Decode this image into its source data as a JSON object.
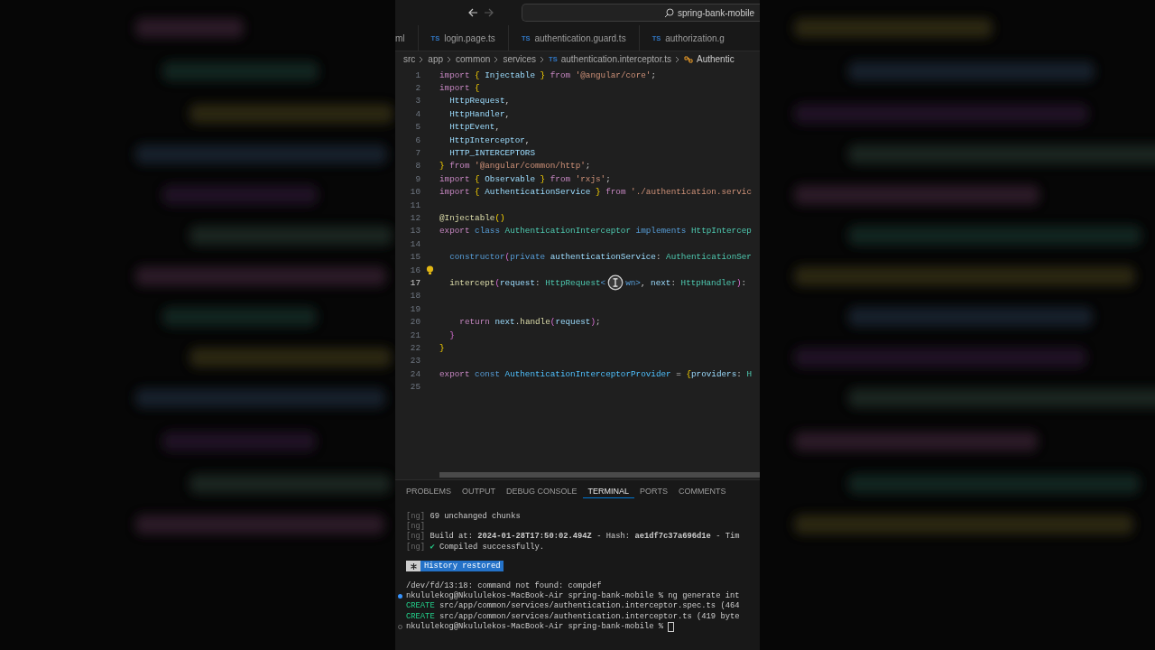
{
  "title_bar": {
    "search": {
      "value": "spring-bank-mobile"
    }
  },
  "tabs": [
    {
      "label": "ml",
      "selected": false
    },
    {
      "label": "login.page.ts",
      "selected": false,
      "badge": "TS"
    },
    {
      "label": "authentication.guard.ts",
      "selected": false,
      "badge": "TS"
    },
    {
      "label": "authorization.g",
      "selected": false,
      "badge": "TS"
    }
  ],
  "breadcrumb": [
    {
      "text": "src",
      "kind": "folder"
    },
    {
      "text": "app",
      "kind": "folder"
    },
    {
      "text": "common",
      "kind": "folder"
    },
    {
      "text": "services",
      "kind": "folder"
    },
    {
      "text": "authentication.interceptor.ts",
      "kind": "file",
      "badge": "TS"
    },
    {
      "text": "Authentic",
      "kind": "class"
    }
  ],
  "editor": {
    "lines": [
      {
        "number": "1",
        "current": false,
        "lightbulb": false,
        "tokens": [
          {
            "kind": "keyword",
            "text": "import "
          },
          {
            "kind": "bracket1",
            "text": "{ "
          },
          {
            "kind": "var",
            "text": "Injectable "
          },
          {
            "kind": "bracket1",
            "text": "} "
          },
          {
            "kind": "keyword",
            "text": "from "
          },
          {
            "kind": "string",
            "text": "'@angular/core'"
          },
          {
            "kind": "plain",
            "text": ";"
          }
        ]
      },
      {
        "number": "2",
        "current": false,
        "lightbulb": false,
        "tokens": [
          {
            "kind": "keyword",
            "text": "import "
          },
          {
            "kind": "bracket1",
            "text": "{"
          }
        ]
      },
      {
        "number": "3",
        "current": false,
        "lightbulb": false,
        "tokens": [
          {
            "kind": "var",
            "text": "  HttpRequest"
          },
          {
            "kind": "plain",
            "text": ","
          }
        ]
      },
      {
        "number": "4",
        "current": false,
        "lightbulb": false,
        "tokens": [
          {
            "kind": "var",
            "text": "  HttpHandler"
          },
          {
            "kind": "plain",
            "text": ","
          }
        ]
      },
      {
        "number": "5",
        "current": false,
        "lightbulb": false,
        "tokens": [
          {
            "kind": "var",
            "text": "  HttpEvent"
          },
          {
            "kind": "plain",
            "text": ","
          }
        ]
      },
      {
        "number": "6",
        "current": false,
        "lightbulb": false,
        "tokens": [
          {
            "kind": "var",
            "text": "  HttpInterceptor"
          },
          {
            "kind": "plain",
            "text": ","
          }
        ]
      },
      {
        "number": "7",
        "current": false,
        "lightbulb": false,
        "tokens": [
          {
            "kind": "var",
            "text": "  HTTP_INTERCEPTORS"
          }
        ]
      },
      {
        "number": "8",
        "current": false,
        "lightbulb": false,
        "tokens": [
          {
            "kind": "bracket1",
            "text": "} "
          },
          {
            "kind": "keyword",
            "text": "from "
          },
          {
            "kind": "string",
            "text": "'@angular/common/http'"
          },
          {
            "kind": "plain",
            "text": ";"
          }
        ]
      },
      {
        "number": "9",
        "current": false,
        "lightbulb": false,
        "tokens": [
          {
            "kind": "keyword",
            "text": "import "
          },
          {
            "kind": "bracket1",
            "text": "{ "
          },
          {
            "kind": "var",
            "text": "Observable "
          },
          {
            "kind": "bracket1",
            "text": "} "
          },
          {
            "kind": "keyword",
            "text": "from "
          },
          {
            "kind": "string",
            "text": "'rxjs'"
          },
          {
            "kind": "plain",
            "text": ";"
          }
        ]
      },
      {
        "number": "10",
        "current": false,
        "lightbulb": false,
        "tokens": [
          {
            "kind": "keyword",
            "text": "import "
          },
          {
            "kind": "bracket1",
            "text": "{ "
          },
          {
            "kind": "var",
            "text": "AuthenticationService "
          },
          {
            "kind": "bracket1",
            "text": "} "
          },
          {
            "kind": "keyword",
            "text": "from "
          },
          {
            "kind": "string",
            "text": "'./authentication.servic"
          }
        ]
      },
      {
        "number": "11",
        "current": false,
        "lightbulb": false
      },
      {
        "number": "12",
        "current": false,
        "lightbulb": false,
        "tokens": [
          {
            "kind": "func",
            "text": "@Injectable"
          },
          {
            "kind": "bracket1",
            "text": "()"
          }
        ]
      },
      {
        "number": "13",
        "current": false,
        "lightbulb": false,
        "tokens": [
          {
            "kind": "keyword",
            "text": "export "
          },
          {
            "kind": "storage",
            "text": "class "
          },
          {
            "kind": "type",
            "text": "AuthenticationInterceptor "
          },
          {
            "kind": "storage",
            "text": "implements "
          },
          {
            "kind": "type",
            "text": "HttpIntercep"
          }
        ]
      },
      {
        "number": "14",
        "current": false,
        "lightbulb": false
      },
      {
        "number": "15",
        "current": false,
        "lightbulb": false,
        "tokens": [
          {
            "kind": "storage",
            "text": "  constructor"
          },
          {
            "kind": "bracket2",
            "text": "("
          },
          {
            "kind": "storage",
            "text": "private "
          },
          {
            "kind": "var",
            "text": "authenticationService"
          },
          {
            "kind": "plain",
            "text": ": "
          },
          {
            "kind": "type",
            "text": "AuthenticationSer"
          }
        ]
      },
      {
        "number": "16",
        "current": false,
        "lightbulb": true
      },
      {
        "number": "17",
        "current": true,
        "lightbulb": false,
        "tokens": [
          {
            "kind": "func",
            "text": "  intercept"
          },
          {
            "kind": "bracket2",
            "text": "("
          },
          {
            "kind": "var",
            "text": "request"
          },
          {
            "kind": "plain",
            "text": ": "
          },
          {
            "kind": "type",
            "text": "HttpRequest"
          },
          {
            "kind": "bracket3",
            "text": "<"
          },
          {
            "kind": "cursor"
          },
          {
            "kind": "bracket3",
            "text": "wn>"
          },
          {
            "kind": "plain",
            "text": ", "
          },
          {
            "kind": "var",
            "text": "next"
          },
          {
            "kind": "plain",
            "text": ": "
          },
          {
            "kind": "type",
            "text": "HttpHandler"
          },
          {
            "kind": "bracket2",
            "text": ")"
          },
          {
            "kind": "plain",
            "text": ":"
          }
        ]
      },
      {
        "number": "18",
        "current": false,
        "lightbulb": false
      },
      {
        "number": "19",
        "current": false,
        "lightbulb": false
      },
      {
        "number": "20",
        "current": false,
        "lightbulb": false,
        "tokens": [
          {
            "kind": "keyword",
            "text": "    return "
          },
          {
            "kind": "var",
            "text": "next"
          },
          {
            "kind": "plain",
            "text": "."
          },
          {
            "kind": "func",
            "text": "handle"
          },
          {
            "kind": "bracket2",
            "text": "("
          },
          {
            "kind": "var",
            "text": "request"
          },
          {
            "kind": "bracket2",
            "text": ")"
          },
          {
            "kind": "plain",
            "text": ";"
          }
        ]
      },
      {
        "number": "21",
        "current": false,
        "lightbulb": false,
        "tokens": [
          {
            "kind": "bracket2",
            "text": "  }"
          }
        ]
      },
      {
        "number": "22",
        "current": false,
        "lightbulb": false,
        "tokens": [
          {
            "kind": "bracket1",
            "text": "}"
          }
        ]
      },
      {
        "number": "23",
        "current": false,
        "lightbulb": false
      },
      {
        "number": "24",
        "current": false,
        "lightbulb": false,
        "tokens": [
          {
            "kind": "keyword",
            "text": "export "
          },
          {
            "kind": "storage",
            "text": "const "
          },
          {
            "kind": "const",
            "text": "AuthenticationInterceptorProvider "
          },
          {
            "kind": "plain",
            "text": "= "
          },
          {
            "kind": "bracket1",
            "text": "{"
          },
          {
            "kind": "var",
            "text": "providers"
          },
          {
            "kind": "plain",
            "text": ": "
          },
          {
            "kind": "type",
            "text": "H"
          }
        ]
      },
      {
        "number": "25",
        "current": false,
        "lightbulb": false
      }
    ]
  },
  "panel": {
    "tabs": [
      {
        "label": "PROBLEMS",
        "selected": false
      },
      {
        "label": "OUTPUT",
        "selected": false
      },
      {
        "label": "DEBUG CONSOLE",
        "selected": false
      },
      {
        "label": "TERMINAL",
        "selected": true
      },
      {
        "label": "PORTS",
        "selected": false
      },
      {
        "label": "COMMENTS",
        "selected": false
      }
    ],
    "terminal": [
      {
        "kind": "ng",
        "prefix": "[ng]",
        "text": "69 unchanged chunks"
      },
      {
        "kind": "ng",
        "prefix": "[ng]"
      },
      {
        "kind": "ng",
        "prefix": "[ng]",
        "text": "Build at: **2024-01-28T17:50:02.494Z** - Hash: **ae1df7c37a696d1e** - Tim"
      },
      {
        "kind": "ng",
        "prefix": "[ng]",
        "check": "✔",
        "text": "Compiled successfully."
      },
      {
        "kind": "badge",
        "text": "History restored"
      },
      {
        "kind": "plain",
        "text": "/dev/fd/13:18: command not found: compdef"
      },
      {
        "kind": "prompt",
        "done": true,
        "cursor": false,
        "text": "nkululekog@Nkululekos-MacBook-Air spring-bank-mobile % ng generate int"
      },
      {
        "kind": "create",
        "tag": "CREATE",
        "text": "src/app/common/services/authentication.interceptor.spec.ts (464"
      },
      {
        "kind": "create",
        "tag": "CREATE",
        "text": "src/app/common/services/authentication.interceptor.ts (419 byte"
      },
      {
        "kind": "prompt",
        "done": false,
        "cursor": true,
        "text": "nkululekog@Nkululekos-MacBook-Air spring-bank-mobile %"
      }
    ]
  }
}
